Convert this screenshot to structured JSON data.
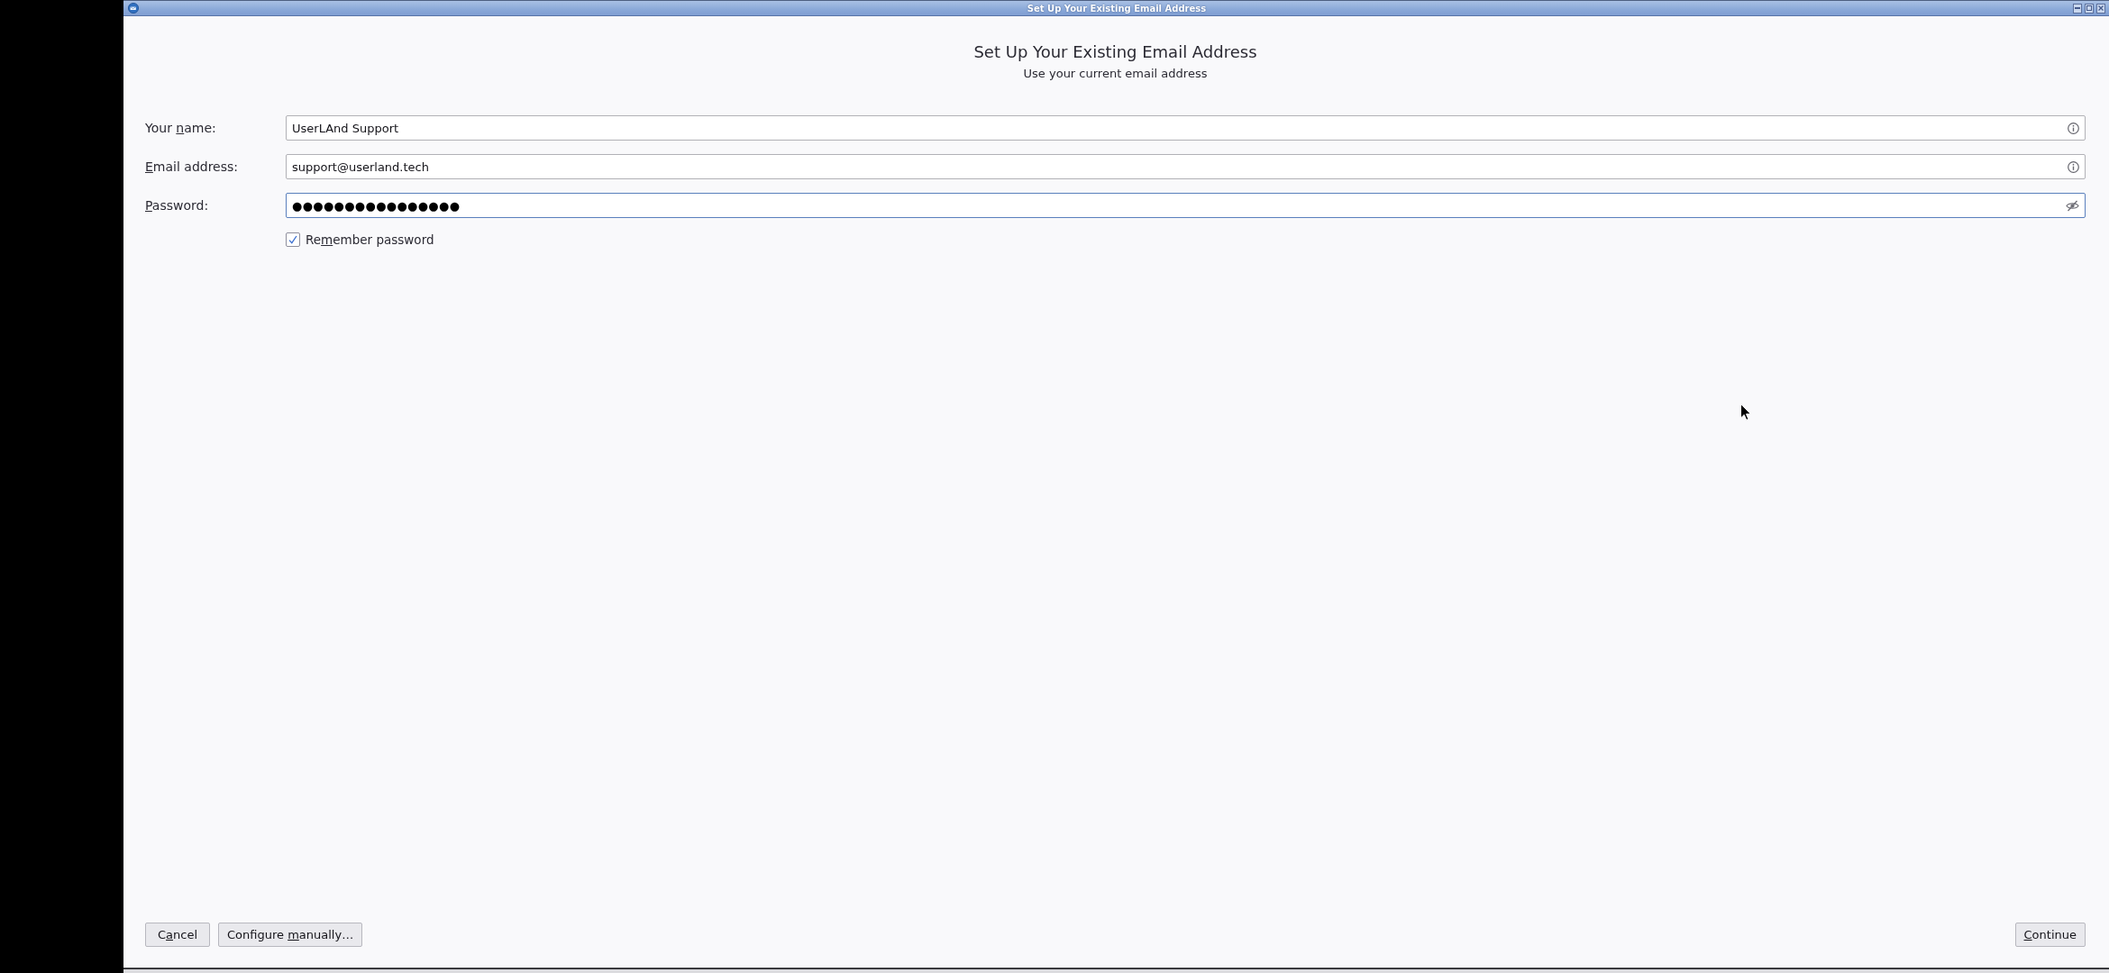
{
  "window": {
    "title": "Set Up Your Existing Email Address"
  },
  "header": {
    "title": "Set Up Your Existing Email Address",
    "subtitle": "Use your current email address"
  },
  "fields": [
    {
      "kind": "text",
      "label_before": "Your ",
      "access_key": "n",
      "label_after": "ame:",
      "value": "UserLAnd Support",
      "focused": false
    },
    {
      "kind": "text",
      "access_key": "E",
      "label_after": "mail address:",
      "value": "support@userland.tech",
      "focused": false
    },
    {
      "kind": "password",
      "access_key": "P",
      "label_after": "assword:",
      "value": "●●●●●●●●●●●●●●●●",
      "focused": true
    }
  ],
  "remember_password": {
    "label_before": "Re",
    "access_key": "m",
    "label_after": "ember password",
    "checked": true
  },
  "footer": {
    "left_buttons": [
      {
        "label_before": "C",
        "access_key": "a",
        "label_after": "ncel"
      },
      {
        "label_before": "Configure ",
        "access_key": "m",
        "label_after": "anually…"
      }
    ],
    "right_buttons": [
      {
        "access_key": "C",
        "label_after": "ontinue"
      }
    ]
  }
}
